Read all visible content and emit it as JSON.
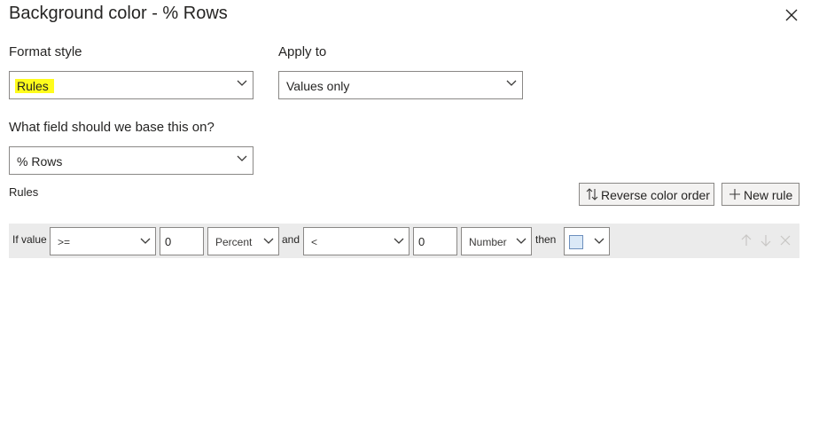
{
  "dialog": {
    "title": "Background color - % Rows"
  },
  "format_style": {
    "label": "Format style",
    "value": "Rules"
  },
  "apply_to": {
    "label": "Apply to",
    "value": "Values only"
  },
  "base_field": {
    "label": "What field should we base this on?",
    "value": "% Rows"
  },
  "rules_section": {
    "label": "Rules",
    "reverse_button": "Reverse color order",
    "new_rule_button": "New rule"
  },
  "rule": {
    "if_value_label": "If value",
    "operator1": ">=",
    "value1": "0",
    "type1": "Percent",
    "and_label": "and",
    "operator2": "<",
    "value2": "0",
    "type2": "Number",
    "then_label": "then",
    "color": "#dbe9f7"
  },
  "colors": {
    "highlight": "#fffc1c",
    "rule_bar": "#ebebeb",
    "border": "#8a8886"
  }
}
